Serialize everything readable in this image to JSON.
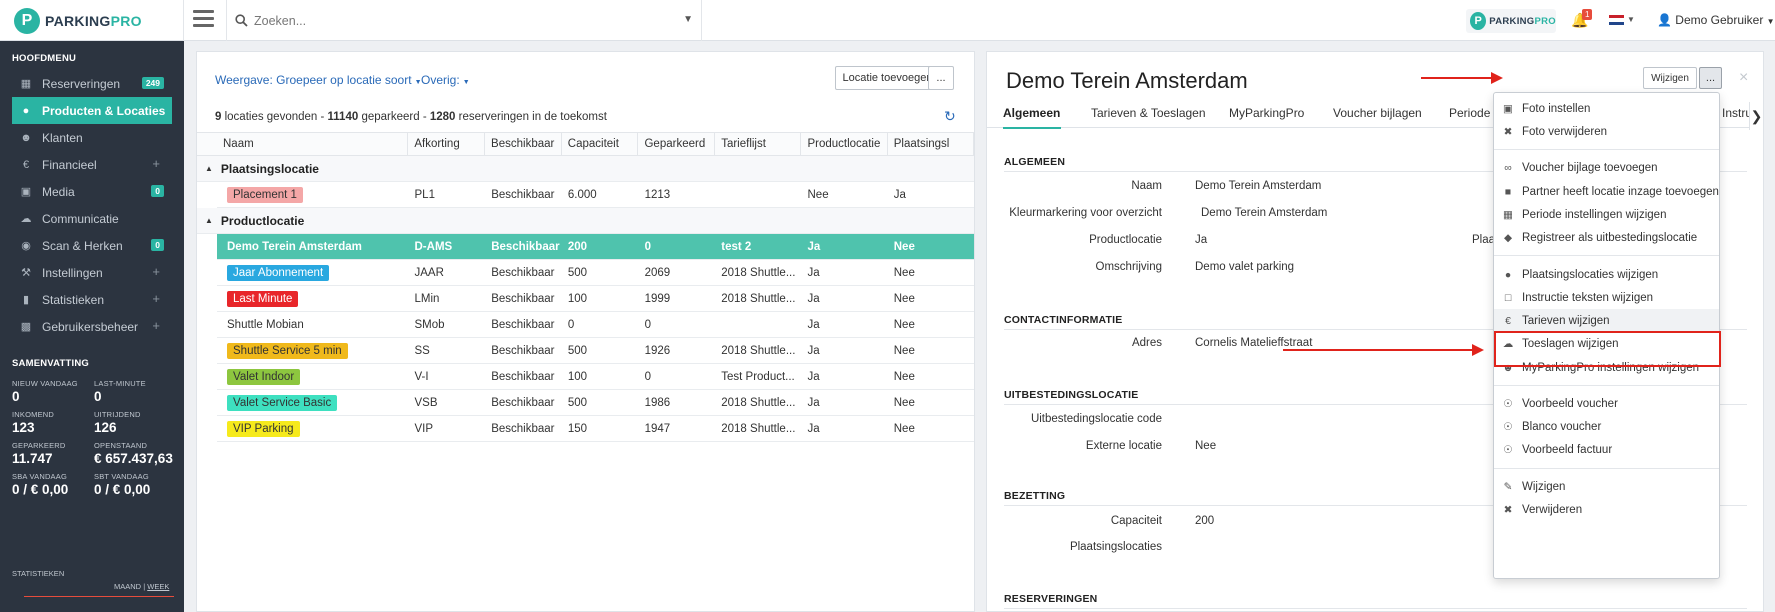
{
  "brand": {
    "name_a": "PARKING",
    "name_b": "PRO",
    "accent": "#2ab4a3",
    "sidebar_bg": "#2c3440",
    "highlight_red": "#e0231b"
  },
  "topbar": {
    "search_placeholder": "Zoeken...",
    "notifications_count": "1",
    "user_name": "Demo Gebruiker"
  },
  "sidebar": {
    "menu_title": "HOOFDMENU",
    "items": [
      {
        "label": "Reserveringen",
        "icon": "calendar-icon",
        "badge": "249"
      },
      {
        "label": "Producten & Locaties",
        "icon": "map-marker-icon",
        "active": true
      },
      {
        "label": "Klanten",
        "icon": "user-icon"
      },
      {
        "label": "Financieel",
        "icon": "euro-icon",
        "plus": "+"
      },
      {
        "label": "Media",
        "icon": "image-icon",
        "badge": "0"
      },
      {
        "label": "Communicatie",
        "icon": "cloud-icon"
      },
      {
        "label": "Scan & Herken",
        "icon": "camera-icon",
        "badge": "0"
      },
      {
        "label": "Instellingen",
        "icon": "wrench-icon",
        "plus": "+"
      },
      {
        "label": "Statistieken",
        "icon": "bar-chart-icon",
        "plus": "+"
      },
      {
        "label": "Gebruikersbeheer",
        "icon": "briefcase-icon",
        "plus": "+"
      }
    ],
    "summary_title": "SAMENVATTING",
    "summary": [
      {
        "label": "NIEUW VANDAAG",
        "value": "0"
      },
      {
        "label": "LAST-MINUTE",
        "value": "0"
      },
      {
        "label": "INKOMEND",
        "value": "123"
      },
      {
        "label": "UITRIJDEND",
        "value": "126"
      },
      {
        "label": "GEPARKEERD",
        "value": "11.747"
      },
      {
        "label": "OPENSTAAND",
        "value": "€ 657.437,63"
      },
      {
        "label": "SBA VANDAAG",
        "value": "0 / € 0,00"
      },
      {
        "label": "SBT VANDAAG",
        "value": "0 / € 0,00"
      }
    ],
    "stats_title": "STATISTIEKEN",
    "stats_month": "MAAND",
    "stats_sep": "|",
    "stats_week": "WEEK"
  },
  "locations": {
    "view_label": "Weergave: Groepeer op locatie soort",
    "other_label": "Overig:",
    "add_button": "Locatie toevoegen",
    "more_button": "...",
    "count_a": "9",
    "count_a_text": " locaties gevonden - ",
    "count_b": "11140",
    "count_b_text": " geparkeerd - ",
    "count_c": "1280",
    "count_c_text": " reserveringen in de toekomst",
    "columns": [
      "Naam",
      "Afkorting",
      "Beschikbaar",
      "Capaciteit",
      "Geparkeerd",
      "Tarieflijst",
      "Productlocatie",
      "Plaatsingsl"
    ],
    "groups": [
      {
        "title": "Plaatsingslocatie",
        "rows": [
          {
            "name": "Placement 1",
            "tag_color": "#f4a7a7",
            "abbr": "PL1",
            "avail": "Beschikbaar",
            "cap": "6.000",
            "parked": "1213",
            "tariff": "",
            "product": "Nee",
            "placement": "Ja"
          }
        ]
      },
      {
        "title": "Productlocatie",
        "rows": [
          {
            "name": "Demo Terein Amsterdam",
            "tag_color": "",
            "selected": true,
            "abbr": "D-AMS",
            "avail": "Beschikbaar",
            "cap": "200",
            "parked": "0",
            "tariff": "test 2",
            "product": "Ja",
            "placement": "Nee"
          },
          {
            "name": "Jaar Abonnement",
            "tag_color": "#29a8e0",
            "abbr": "JAAR",
            "avail": "Beschikbaar",
            "cap": "500",
            "parked": "2069",
            "tariff": "2018 Shuttle...",
            "product": "Ja",
            "placement": "Nee"
          },
          {
            "name": "Last Minute",
            "tag_color": "#e8262a",
            "abbr": "LMin",
            "avail": "Beschikbaar",
            "cap": "100",
            "parked": "1999",
            "tariff": "2018 Shuttle...",
            "product": "Ja",
            "placement": "Nee"
          },
          {
            "name": "Shuttle Mobian",
            "tag_color": "",
            "abbr": "SMob",
            "avail": "Beschikbaar",
            "cap": "0",
            "parked": "0",
            "tariff": "",
            "product": "Ja",
            "placement": "Nee"
          },
          {
            "name": "Shuttle Service 5 min",
            "tag_color": "#f0b91b",
            "abbr": "SS",
            "avail": "Beschikbaar",
            "cap": "500",
            "parked": "1926",
            "tariff": "2018 Shuttle...",
            "product": "Ja",
            "placement": "Nee"
          },
          {
            "name": "Valet Indoor",
            "tag_color": "#8dc63f",
            "abbr": "V-I",
            "avail": "Beschikbaar",
            "cap": "100",
            "parked": "0",
            "tariff": "Test Product...",
            "product": "Ja",
            "placement": "Nee"
          },
          {
            "name": "Valet Service Basic",
            "tag_color": "#3ee0c0",
            "abbr": "VSB",
            "avail": "Beschikbaar",
            "cap": "500",
            "parked": "1986",
            "tariff": "2018 Shuttle...",
            "product": "Ja",
            "placement": "Nee"
          },
          {
            "name": "VIP Parking",
            "tag_color": "#f6ea1c",
            "abbr": "VIP",
            "avail": "Beschikbaar",
            "cap": "150",
            "parked": "1947",
            "tariff": "2018 Shuttle...",
            "product": "Ja",
            "placement": "Nee"
          }
        ]
      }
    ]
  },
  "detail": {
    "title": "Demo Terein Amsterdam",
    "edit_button": "Wijzigen",
    "edit_more": "...",
    "close": "×",
    "tabs": [
      "Algemeen",
      "Tarieven & Toeslagen",
      "MyParkingPro",
      "Voucher bijlagen",
      "Periode i",
      "Instru"
    ],
    "sections": {
      "general": "ALGEMEEN",
      "contact": "CONTACTINFORMATIE",
      "outsourcing": "UITBESTEDINGSLOCATIE",
      "occupancy": "BEZETTING",
      "reservations": "RESERVERINGEN"
    },
    "fields": {
      "name_k": "Naam",
      "name_v": "Demo Terein Amsterdam",
      "color_k": "Kleurmarkering voor overzicht",
      "color_v": "Demo Terein Amsterdam",
      "product_k": "Productlocatie",
      "product_v": "Ja",
      "product_right_k": "Plaa",
      "desc_k": "Omschrijving",
      "desc_v": "Demo valet parking",
      "address_k": "Adres",
      "address_v": "Cornelis Matelieffstraat",
      "out_code_k": "Uitbestedingslocatie code",
      "out_code_v": "",
      "external_k": "Externe locatie",
      "external_v": "Nee",
      "capacity_k": "Capaciteit",
      "capacity_v": "200",
      "placements_k": "Plaatsingslocaties",
      "placements_v": ""
    }
  },
  "menu": {
    "items": [
      {
        "label": "Foto instellen",
        "icon": "image-icon"
      },
      {
        "label": "Foto verwijderen",
        "icon": "times-icon"
      },
      {
        "label": "Voucher bijlage toevoegen",
        "icon": "paperclip-icon"
      },
      {
        "label": "Partner heeft locatie inzage toevoegen",
        "icon": "lock-icon"
      },
      {
        "label": "Periode instellingen wijzigen",
        "icon": "calendar-icon"
      },
      {
        "label": "Registreer als uitbestedingslocatie",
        "icon": "tags-icon"
      },
      {
        "label": "Plaatsingslocaties wijzigen",
        "icon": "map-marker-icon"
      },
      {
        "label": "Instructie teksten wijzigen",
        "icon": "file-icon"
      },
      {
        "label": "Tarieven wijzigen",
        "icon": "euro-icon",
        "highlight": true
      },
      {
        "label": "Toeslagen wijzigen",
        "icon": "cloud-icon"
      },
      {
        "label": "MyParkingPro instellingen wijzigen",
        "icon": "user-icon"
      },
      {
        "label": "Voorbeeld voucher",
        "icon": "download-icon"
      },
      {
        "label": "Blanco voucher",
        "icon": "download-icon"
      },
      {
        "label": "Voorbeeld factuur",
        "icon": "download-icon"
      },
      {
        "label": "Wijzigen",
        "icon": "pencil-icon"
      },
      {
        "label": "Verwijderen",
        "icon": "times-icon"
      }
    ]
  }
}
